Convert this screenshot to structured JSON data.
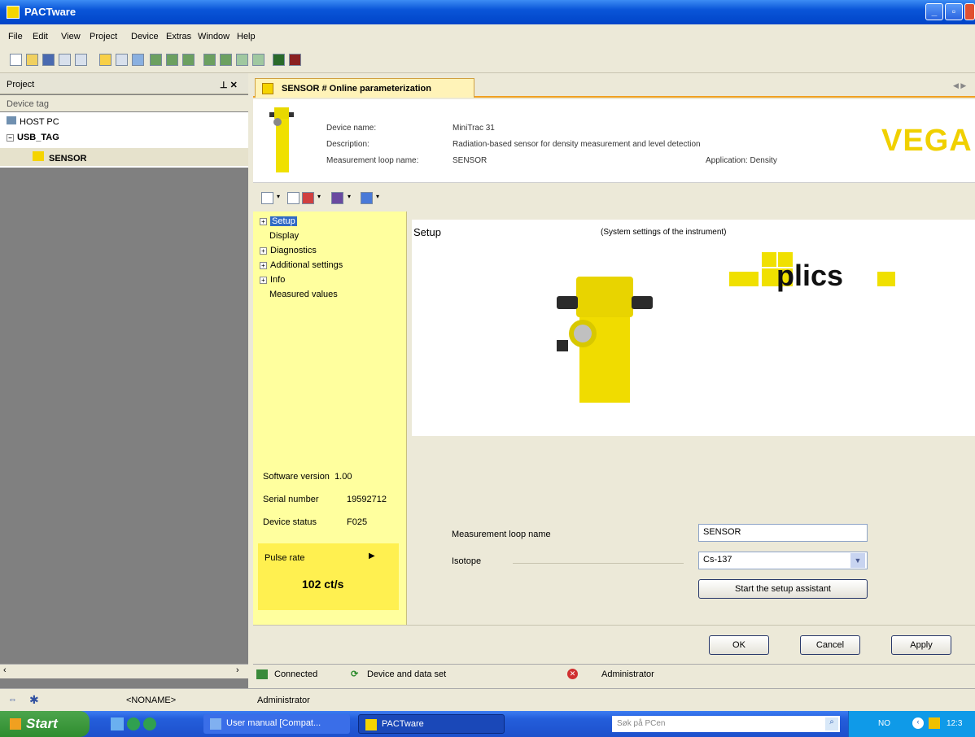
{
  "window": {
    "title": "PACTware"
  },
  "menu": [
    "File",
    "Edit",
    "View",
    "Project",
    "Device",
    "Extras",
    "Window",
    "Help"
  ],
  "project": {
    "panel_title": "Project",
    "column": "Device tag",
    "tree": [
      "HOST PC",
      "USB_TAG",
      "SENSOR"
    ]
  },
  "tab": {
    "title": "SENSOR # Online parameterization"
  },
  "device": {
    "name_label": "Device name:",
    "name_value": "MiniTrac 31",
    "desc_label": "Description:",
    "desc_value": "Radiation-based sensor for density measurement and level detection",
    "loop_label": "Measurement loop name:",
    "loop_value": "SENSOR",
    "application": "Application: Density",
    "brand": "VEGA"
  },
  "nav": {
    "items": [
      "Setup",
      "Display",
      "Diagnostics",
      "Additional settings",
      "Info",
      "Measured values"
    ]
  },
  "info": {
    "sw_label": "Software version",
    "sw_value": "1.00",
    "serial_label": "Serial number",
    "serial_value": "19592712",
    "status_label": "Device status",
    "status_value": "F025",
    "pulse_label": "Pulse rate",
    "pulse_value": "102 ct/s"
  },
  "main": {
    "heading": "Setup",
    "subtitle": "(System settings of the instrument)",
    "plics": "plics",
    "loop_label": "Measurement loop name",
    "loop_value": "SENSOR",
    "isotope_label": "Isotope",
    "isotope_value": "Cs-137",
    "assistant_button": "Start the setup assistant"
  },
  "buttons": {
    "ok": "OK",
    "cancel": "Cancel",
    "apply": "Apply"
  },
  "status": {
    "connected": "Connected",
    "device": "Device and data set",
    "user": "Administrator"
  },
  "bottombar": {
    "project": "<NONAME>",
    "user": "Administrator"
  },
  "taskbar": {
    "start": "Start",
    "task1": "User manual [Compat...",
    "task2": "PACTware",
    "search": "Søk på PCen",
    "lang": "NO",
    "clock": "12:3"
  }
}
